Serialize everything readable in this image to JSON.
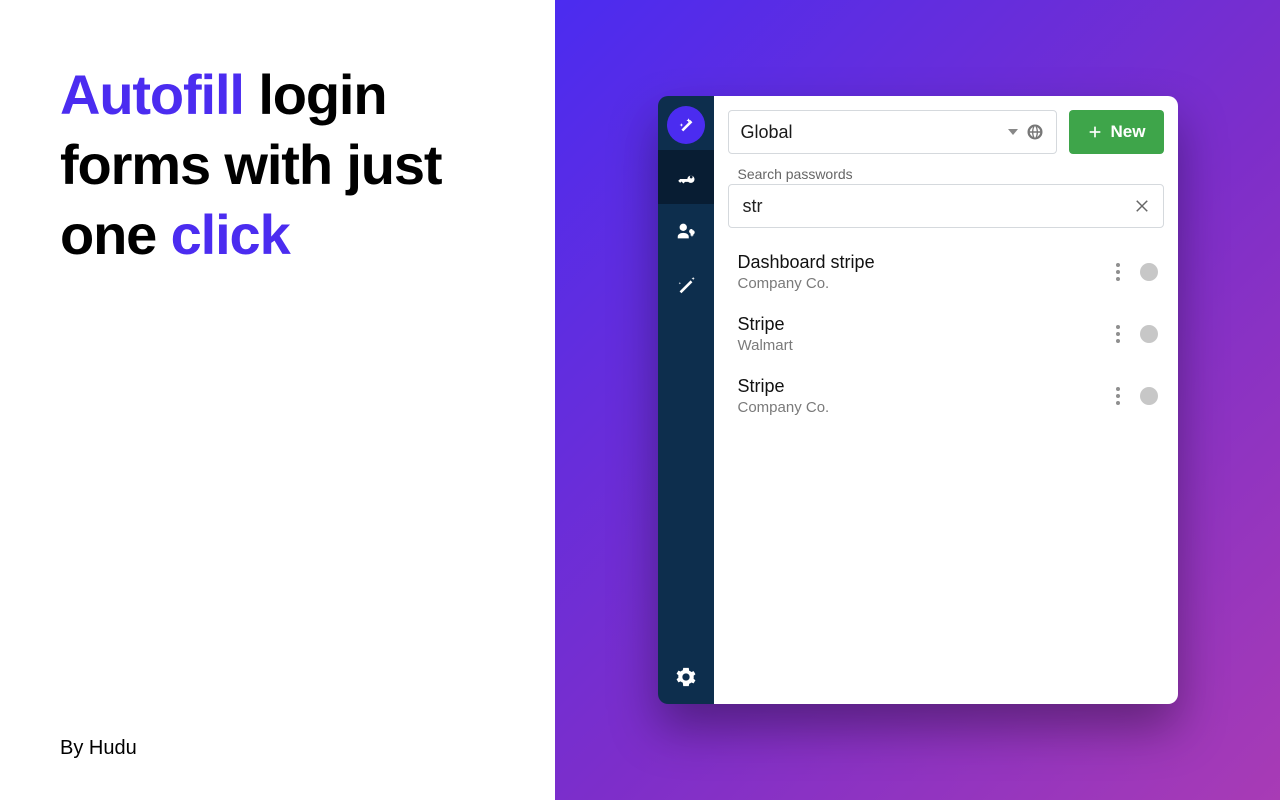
{
  "marketing": {
    "headline_parts": {
      "p1": "Autofill",
      "p2": " login forms with just one ",
      "p3": "click"
    },
    "byline": "By Hudu"
  },
  "app": {
    "scope": {
      "selected": "Global"
    },
    "new_button": "New",
    "search": {
      "label": "Search passwords",
      "value": "str"
    },
    "results": [
      {
        "title": "Dashboard stripe",
        "subtitle": "Company Co."
      },
      {
        "title": "Stripe",
        "subtitle": "Walmart"
      },
      {
        "title": "Stripe",
        "subtitle": "Company Co."
      }
    ]
  },
  "colors": {
    "accent": "#4b2cf0",
    "new_button_bg": "#3ea54a",
    "sidebar_bg": "#0d2e4d"
  }
}
